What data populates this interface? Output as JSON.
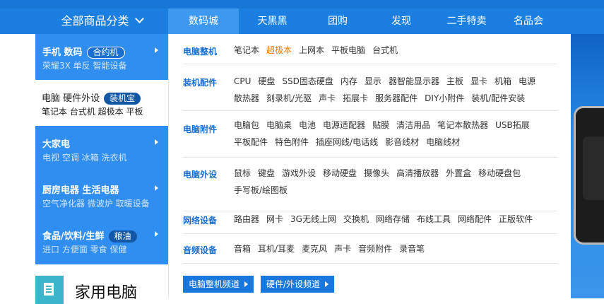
{
  "header": {
    "all_categories": "全部商品分类",
    "tabs": [
      "数码城",
      "天黑黑",
      "团购",
      "发现",
      "二手特卖",
      "名品会"
    ]
  },
  "sidebar": {
    "categories": [
      {
        "title": "手机 数码",
        "badge": "合约机",
        "subtitle": "荣耀3X 单反 智能设备"
      },
      {
        "title": "电脑 硬件外设",
        "badge": "装机宝",
        "subtitle": "笔记本 台式机 超极本 平板"
      },
      {
        "title": "大家电",
        "badge": "",
        "subtitle": "电视 空调 冰箱 洗衣机"
      },
      {
        "title": "厨房电器 生活电器",
        "badge": "",
        "subtitle": "空气净化器 微波炉 取暖设备"
      },
      {
        "title": "食品/饮料/生鲜",
        "badge": "粮油",
        "subtitle": "进口 方便面 零食 保健"
      }
    ],
    "floor_title": "家用电脑"
  },
  "panel": {
    "rows": [
      {
        "title": "电脑整机",
        "links": [
          "笔记本",
          "超极本",
          "上网本",
          "平板电脑",
          "台式机"
        ],
        "highlight": 1
      },
      {
        "title": "装机配件",
        "links": [
          "CPU",
          "硬盘",
          "SSD固态硬盘",
          "内存",
          "显示",
          "器智能显示器",
          "主板",
          "显卡",
          "机箱",
          "电源",
          "散热器",
          "刻录机/光驱",
          "声卡",
          "拓展卡",
          "服务器配件",
          "DIY小附件",
          "装机/配件安装"
        ]
      },
      {
        "title": "电脑附件",
        "links": [
          "电脑包",
          "电脑桌",
          "电池",
          "电源适配器",
          "贴膜",
          "清洁用品",
          "笔记本散热器",
          "USB拓展",
          "平板配件",
          "特色附件",
          "插座网线/电话线",
          "影音线材",
          "电脑线材"
        ]
      },
      {
        "title": "电脑外设",
        "links": [
          "鼠标",
          "键盘",
          "游戏外设",
          "移动硬盘",
          "摄像头",
          "高清播放器",
          "外置盒",
          "移动硬盘包",
          "手写板/绘图板"
        ]
      },
      {
        "title": "网络设备",
        "links": [
          "路由器",
          "网卡",
          "3G无线上网",
          "交换机",
          "网络存储",
          "布线工具",
          "网络配件",
          "正版软件"
        ]
      },
      {
        "title": "音频设备",
        "links": [
          "音箱",
          "耳机/耳麦",
          "麦克风",
          "声卡",
          "音频附件",
          "录音笔"
        ]
      }
    ],
    "channel_buttons": [
      "电脑整机频道",
      "硬件/外设频道"
    ]
  },
  "colors": {
    "nav": "#1a7fe0",
    "sidebar": "#2f8ef0",
    "row_title": "#1a6fcf",
    "highlight": "#f07800"
  }
}
